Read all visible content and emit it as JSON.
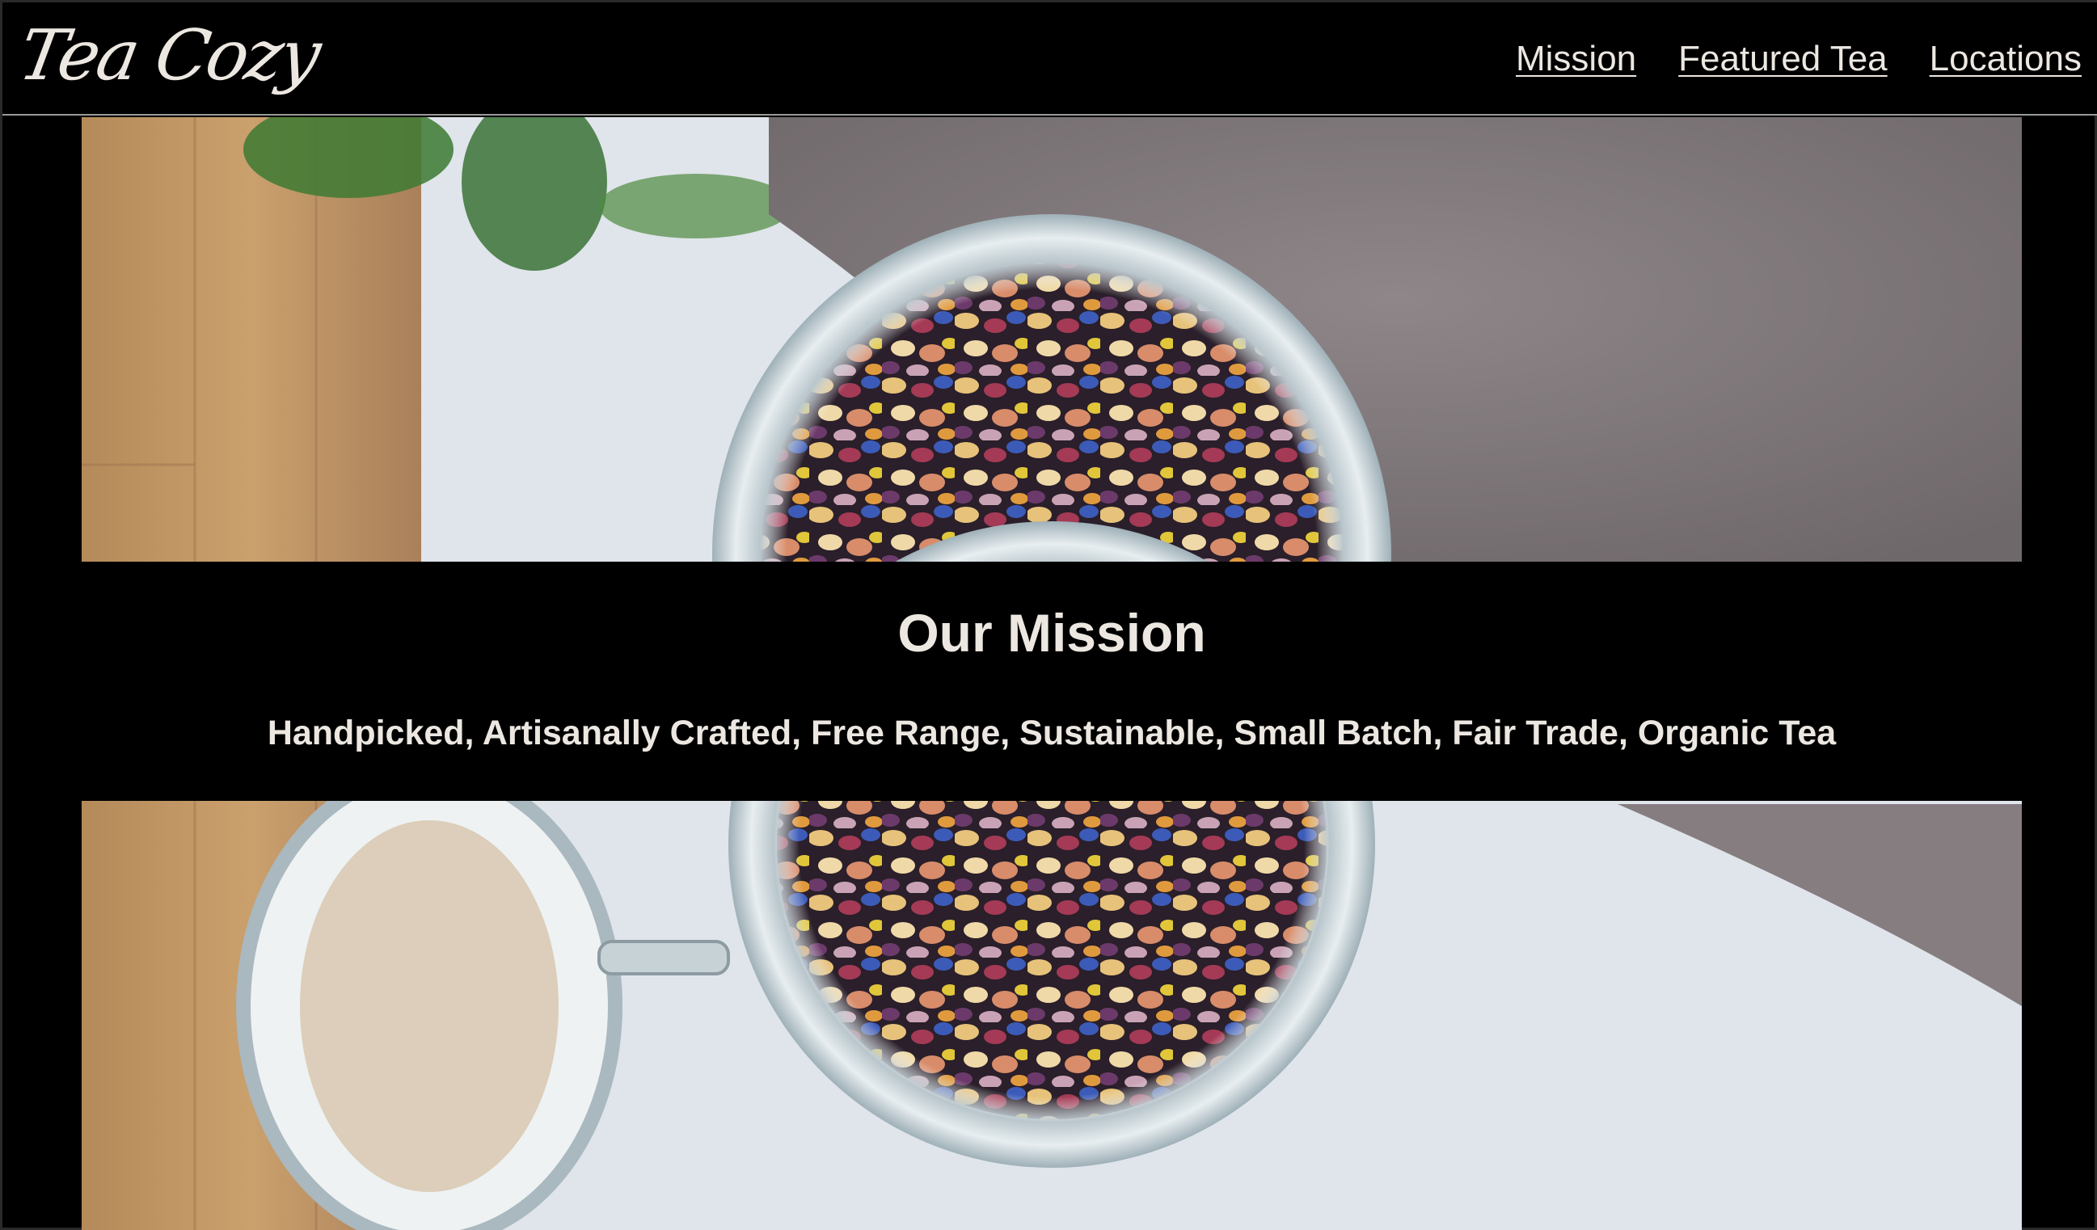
{
  "header": {
    "logo_text": "Tea Cozy",
    "nav": [
      {
        "label": "Mission"
      },
      {
        "label": "Featured Tea"
      },
      {
        "label": "Locations"
      }
    ]
  },
  "hero": {
    "image_subject": "tea-jar-photo"
  },
  "mission": {
    "title": "Our Mission",
    "text": "Handpicked, Artisanally Crafted, Free Range, Sustainable, Small Batch, Fair Trade, Organic Tea"
  },
  "colors": {
    "background": "#000000",
    "text": "#ece7e1"
  }
}
